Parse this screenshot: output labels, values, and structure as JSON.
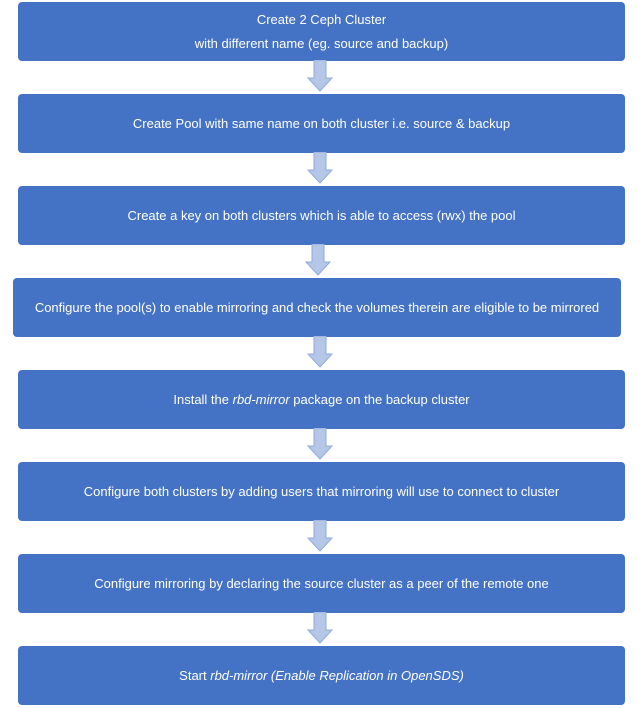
{
  "steps": [
    {
      "lines": [
        "Create 2 Ceph Cluster",
        "with different name (eg. source and backup)"
      ]
    },
    {
      "text": "Create Pool with same name on both cluster i.e. source & backup"
    },
    {
      "text": "Create a key on both clusters which is able to access (rwx) the pool"
    },
    {
      "text": "Configure the pool(s) to enable mirroring and check the volumes therein are eligible to be mirrored"
    },
    {
      "before": "Install the ",
      "italic": "rbd-mirror",
      "after": " package on the backup cluster"
    },
    {
      "text": "Configure both clusters by adding users that mirroring will use to connect to cluster"
    },
    {
      "text": "Configure mirroring by declaring the source cluster as a peer of the remote one"
    },
    {
      "before": "Start ",
      "italic": "rbd-mirror (Enable Replication in OpenSDS)",
      "after": ""
    }
  ],
  "colors": {
    "box": "#4472c4",
    "box_text": "#ffffff",
    "arrow_fill": "#b4c7e7",
    "arrow_stroke": "#8faadc"
  }
}
